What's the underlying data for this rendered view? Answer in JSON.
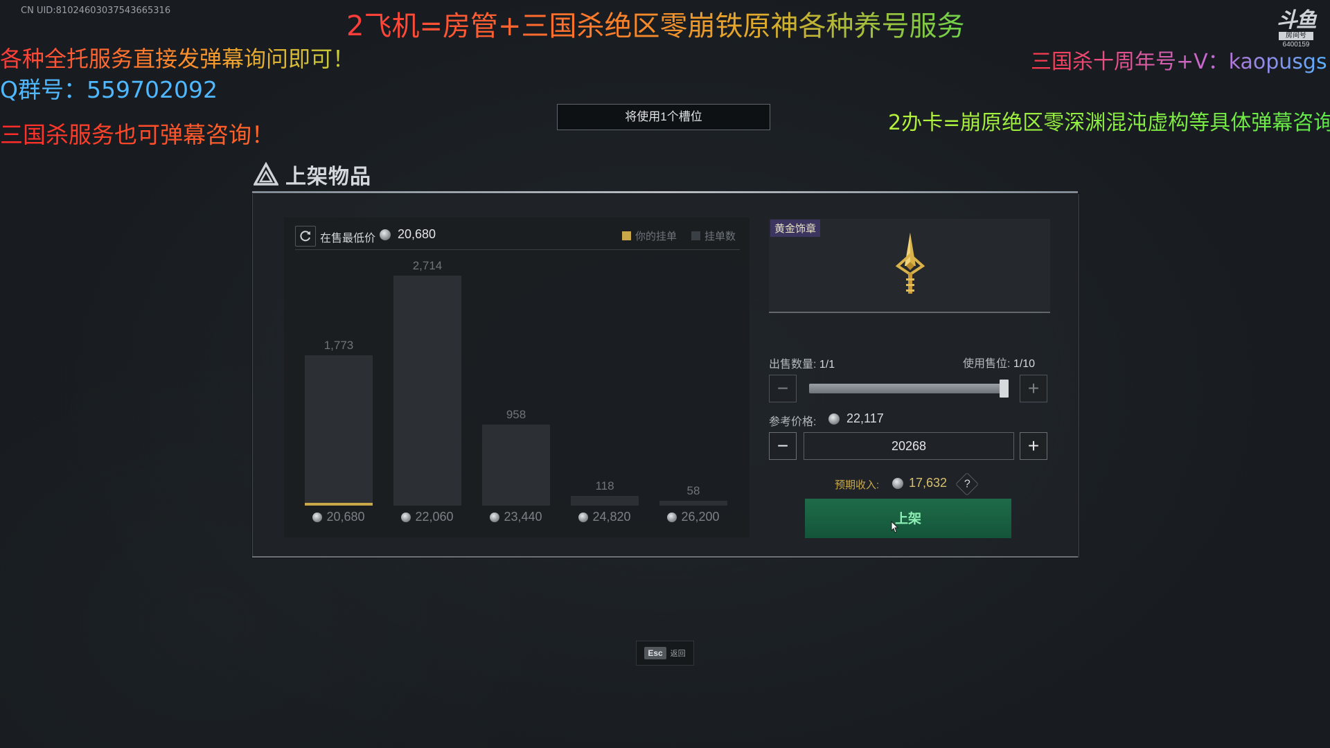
{
  "overlay": {
    "uid": "CN UID:81024603037543665316",
    "title": "2飞机=房管+三国杀绝区零崩铁原神各种养号服务",
    "left_line1": "各种全托服务直接发弹幕询问即可！",
    "left_line2": "Q群号：559702092",
    "left_line3": "三国杀服务也可弹幕咨询！",
    "right_line1": "三国杀十周年号+V：kaopusgs",
    "right_line2": "2办卡=崩原绝区零深渊混沌虚构等具体弹幕咨询",
    "logo_main": "斗鱼",
    "logo_sub": "房间号",
    "logo_num": "6400159"
  },
  "slot_notice": "将使用1个槽位",
  "panel": {
    "title": "上架物品",
    "lowest_price_label": "在售最低价",
    "lowest_price": "20,680",
    "legend_yours": "你的挂单",
    "legend_count": "挂单数",
    "item_tag": "黄金饰章",
    "sell_qty_label": "出售数量:",
    "sell_qty": "1/1",
    "slot_use_label": "使用售位:",
    "slot_use": "1/10",
    "ref_price_label": "参考价格:",
    "ref_price": "22,117",
    "price_input": "20268",
    "income_label": "预期收入:",
    "income": "17,632",
    "help": "?",
    "list_button": "上架",
    "qty_fill": 1.0
  },
  "chart_data": {
    "type": "bar",
    "categories": [
      "20,680",
      "22,060",
      "23,440",
      "24,820",
      "26,200"
    ],
    "values": [
      1773,
      2714,
      958,
      118,
      58
    ],
    "value_labels": [
      "1,773",
      "2,714",
      "958",
      "118",
      "58"
    ],
    "highlight_index": 0,
    "series": [
      {
        "name": "挂单数",
        "values": [
          1773,
          2714,
          958,
          118,
          58
        ]
      }
    ],
    "ylim": [
      0,
      2714
    ]
  },
  "footer": {
    "esc_key": "Esc",
    "esc_label": "返回"
  },
  "colors": {
    "accent_gold": "#c9a84a",
    "list_button": "#1e6b48",
    "bar": "#2c3035"
  }
}
